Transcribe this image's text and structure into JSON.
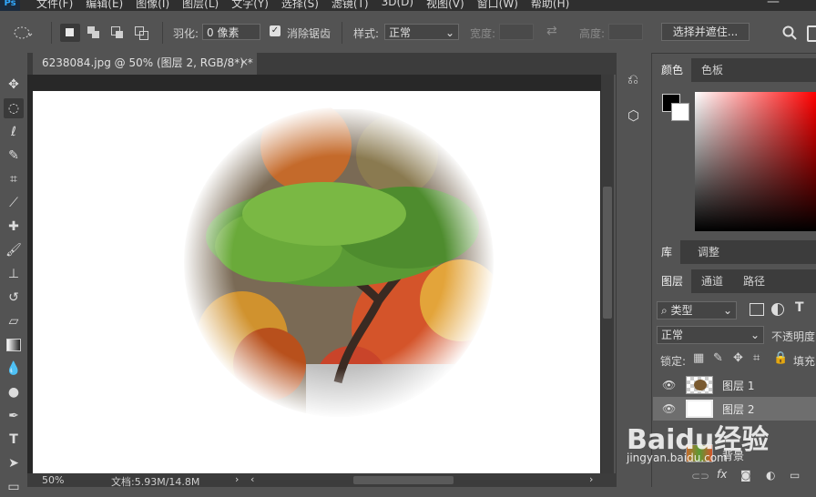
{
  "app": {
    "logo": "Ps"
  },
  "menu": [
    "文件(F)",
    "编辑(E)",
    "图像(I)",
    "图层(L)",
    "文字(Y)",
    "选择(S)",
    "滤镜(T)",
    "3D(D)",
    "视图(V)",
    "窗口(W)",
    "帮助(H)"
  ],
  "options": {
    "feather_label": "羽化:",
    "feather_value": "0 像素",
    "antialias_label": "消除锯齿",
    "style_label": "样式:",
    "style_value": "正常",
    "width_label": "宽度:",
    "height_label": "高度:",
    "select_mask_label": "选择并遮住..."
  },
  "document": {
    "tab_title": "6238084.jpg @ 50% (图层 2, RGB/8*) *",
    "zoom": "50%",
    "doc_info": "文档:5.93M/14.8M"
  },
  "panels": {
    "color_tabs": [
      "颜色",
      "色板"
    ],
    "lib_tabs": [
      "库",
      "调整"
    ],
    "layer_tabs": [
      "图层",
      "通道",
      "路径"
    ],
    "kind_filter": "类型",
    "blend_mode": "正常",
    "opacity_label": "不透明度",
    "lock_label": "锁定:",
    "fill_label": "填充"
  },
  "layers": [
    {
      "name": "图层 1",
      "selected": false
    },
    {
      "name": "图层 2",
      "selected": true
    },
    {
      "name": "背景",
      "selected": false
    }
  ],
  "watermark": {
    "brand": "Baidu经验",
    "url": "jingyan.baidu.com"
  },
  "colors": {
    "accent": "#31a8ff",
    "panel": "#535353",
    "dark": "#3c3c3c"
  }
}
